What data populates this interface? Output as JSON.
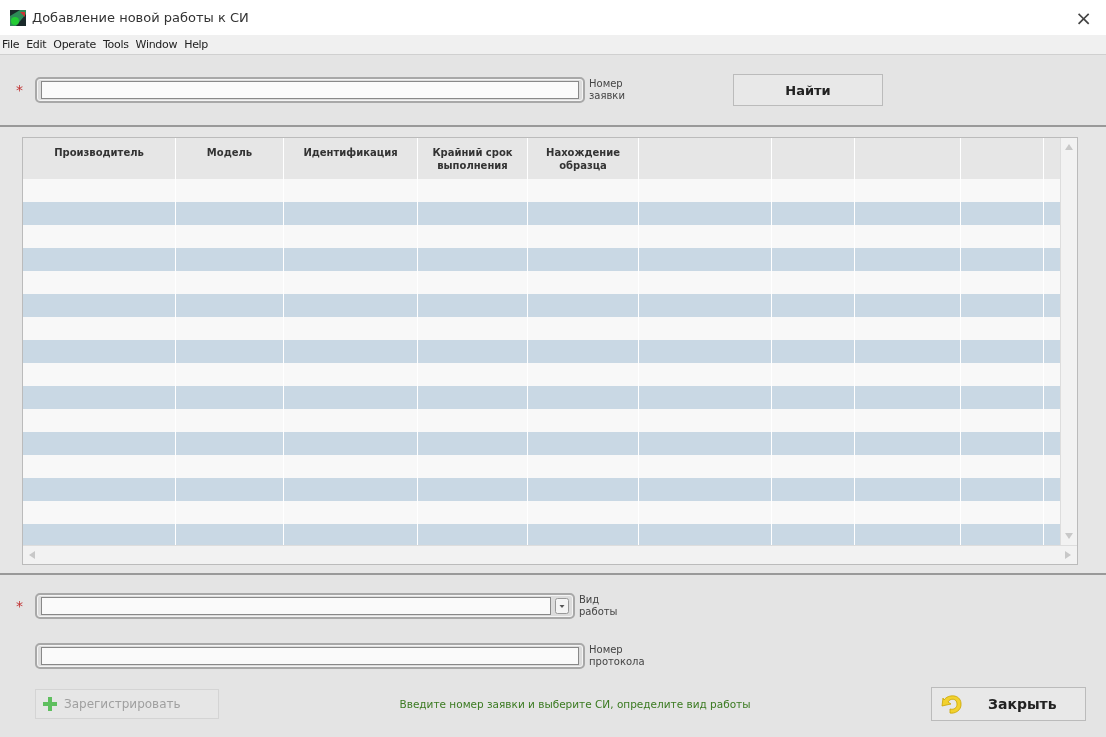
{
  "window": {
    "title": "Добавление новой работы к СИ",
    "close": "×"
  },
  "menu": [
    "File",
    "Edit",
    "Operate",
    "Tools",
    "Window",
    "Help"
  ],
  "request_field": {
    "required": true,
    "required_mark": "*",
    "label": "Номер заявки"
  },
  "find_button": {
    "label": "Найти"
  },
  "table": {
    "columns": [
      "Производитель",
      "Модель",
      "Идентификация",
      "Крайний срок выполнения",
      "Нахождение образца"
    ]
  },
  "work_type_field": {
    "required": true,
    "required_mark": "*",
    "label": "Вид работы"
  },
  "protocol_field": {
    "label": "Номер протокола"
  },
  "register_button": {
    "label": "Зарегистрировать",
    "disabled": true
  },
  "status_message": "Введите номер заявки и выберите СИ, определите вид работы",
  "close_button": {
    "label": "Закрыть"
  }
}
